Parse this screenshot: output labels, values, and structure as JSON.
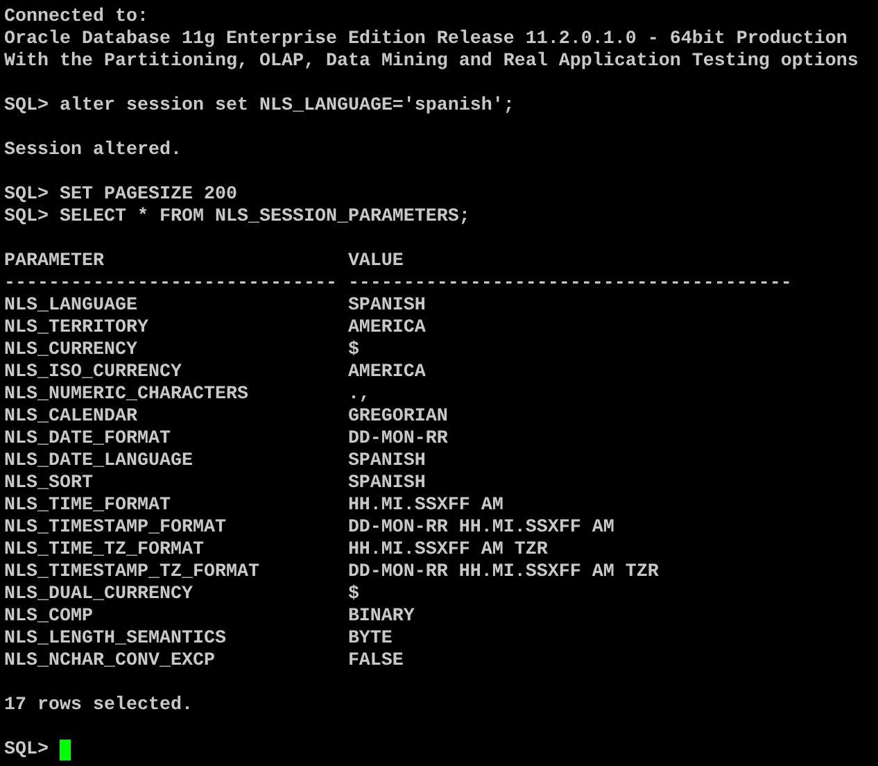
{
  "terminal": {
    "blocks": [
      [
        "Connected to:",
        "Oracle Database 11g Enterprise Edition Release 11.2.0.1.0 - 64bit Production",
        "With the Partitioning, OLAP, Data Mining and Real Application Testing options"
      ],
      [
        "SQL> alter session set NLS_LANGUAGE='spanish';"
      ],
      [
        "Session altered."
      ],
      [
        "SQL> SET PAGESIZE 200",
        "SQL> SELECT * FROM NLS_SESSION_PARAMETERS;"
      ]
    ],
    "table": {
      "columns": [
        "PARAMETER",
        "VALUE"
      ],
      "rules": [
        "------------------------------",
        "----------------------------------------"
      ],
      "rows": [
        [
          "NLS_LANGUAGE",
          "SPANISH"
        ],
        [
          "NLS_TERRITORY",
          "AMERICA"
        ],
        [
          "NLS_CURRENCY",
          "$"
        ],
        [
          "NLS_ISO_CURRENCY",
          "AMERICA"
        ],
        [
          "NLS_NUMERIC_CHARACTERS",
          ".,"
        ],
        [
          "NLS_CALENDAR",
          "GREGORIAN"
        ],
        [
          "NLS_DATE_FORMAT",
          "DD-MON-RR"
        ],
        [
          "NLS_DATE_LANGUAGE",
          "SPANISH"
        ],
        [
          "NLS_SORT",
          "SPANISH"
        ],
        [
          "NLS_TIME_FORMAT",
          "HH.MI.SSXFF AM"
        ],
        [
          "NLS_TIMESTAMP_FORMAT",
          "DD-MON-RR HH.MI.SSXFF AM"
        ],
        [
          "NLS_TIME_TZ_FORMAT",
          "HH.MI.SSXFF AM TZR"
        ],
        [
          "NLS_TIMESTAMP_TZ_FORMAT",
          "DD-MON-RR HH.MI.SSXFF AM TZR"
        ],
        [
          "NLS_DUAL_CURRENCY",
          "$"
        ],
        [
          "NLS_COMP",
          "BINARY"
        ],
        [
          "NLS_LENGTH_SEMANTICS",
          "BYTE"
        ],
        [
          "NLS_NCHAR_CONV_EXCP",
          "FALSE"
        ]
      ]
    },
    "footer": "17 rows selected.",
    "prompt": "SQL>"
  }
}
